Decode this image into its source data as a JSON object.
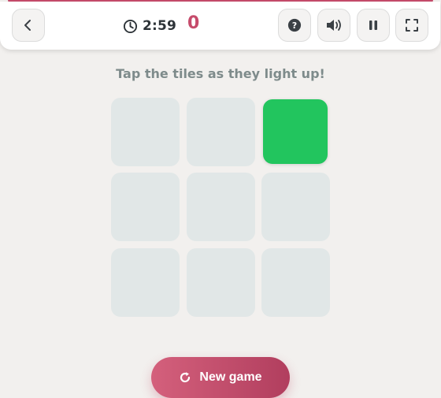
{
  "header": {
    "time": "2:59",
    "score": "0",
    "buttons": {
      "back": "chevron-left-icon",
      "help": "help-icon",
      "sound": "speaker-icon",
      "pause": "pause-icon",
      "fullscreen": "fullscreen-icon"
    }
  },
  "instruction": "Tap the tiles as they light up!",
  "board": {
    "rows": 3,
    "cols": 3,
    "lit_tile": {
      "row": 1,
      "col": 3
    }
  },
  "new_game_label": "New game",
  "colors": {
    "accent": "#c64b6b",
    "tile": "#e1e7e7",
    "tile_lit": "#22c55e",
    "background": "#f2f0ee",
    "text": "#2d3338",
    "instruction": "#7e8b8b"
  }
}
